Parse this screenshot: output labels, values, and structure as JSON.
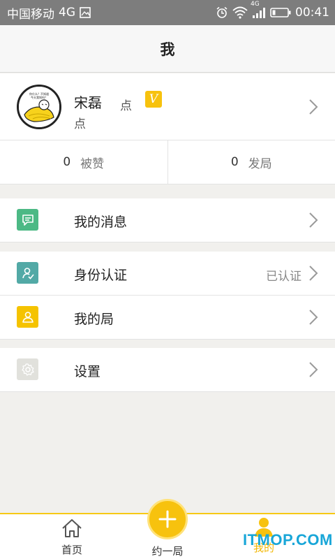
{
  "status_bar": {
    "carrier": "中国移动",
    "network": "4G",
    "network_small": "4G",
    "time": "00:41"
  },
  "nav": {
    "title": "我"
  },
  "profile": {
    "name": "宋磊",
    "line1_suffix": "点",
    "badge": "V",
    "line2": "点",
    "avatar_caption_line1": "你什么？不知道",
    "avatar_caption_line2": "今天我知吗？"
  },
  "stats": [
    {
      "count": "0",
      "label": "被赞"
    },
    {
      "count": "0",
      "label": "发局"
    }
  ],
  "menu": {
    "messages": {
      "label": "我的消息"
    },
    "identity": {
      "label": "身份认证",
      "status": "已认证"
    },
    "my_games": {
      "label": "我的局"
    },
    "settings": {
      "label": "设置"
    }
  },
  "tabbar": {
    "home": "首页",
    "create": "约一局",
    "me": "我的"
  },
  "watermark": "ITMOP.COM",
  "colors": {
    "accent": "#f7c20e",
    "message_icon": "#4cb985",
    "identity_icon": "#52a9a6",
    "games_icon": "#f5c300",
    "settings_icon": "#e1e1dc",
    "watermark": "#18a6d8"
  }
}
